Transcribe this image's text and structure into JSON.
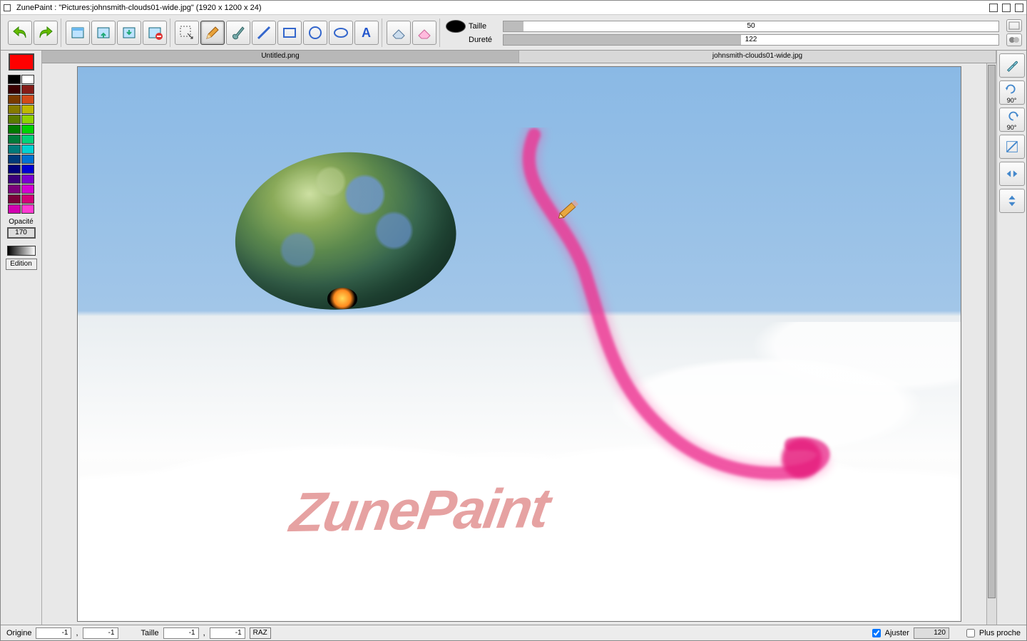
{
  "app_name": "ZunePaint",
  "title_suffix": " : \"Pictures:johnsmith-clouds01-wide.jpg\" (1920 x 1200 x 24)",
  "toolbar": {
    "taille_label": "Taille",
    "taille_value": "50",
    "taille_pct": 4,
    "durete_label": "Dureté",
    "durete_value": "122",
    "durete_pct": 48
  },
  "tabs": [
    {
      "label": "Untitled.png",
      "active": false
    },
    {
      "label": "johnsmith-clouds01-wide.jpg",
      "active": true
    }
  ],
  "palette": {
    "current": "#ff0000",
    "opacity_label": "Opacité",
    "opacity_value": "170",
    "edition_label": "Edition",
    "colors": [
      "#000000",
      "#ffffff",
      "#3a0000",
      "#861c17",
      "#7a3a00",
      "#d24a1a",
      "#867a00",
      "#bfb800",
      "#5a7a00",
      "#8fd200",
      "#007a00",
      "#00d200",
      "#007a3a",
      "#00d27a",
      "#007a7a",
      "#00d2d2",
      "#003a7a",
      "#0072d2",
      "#00007a",
      "#0000d2",
      "#3a007a",
      "#7a00d2",
      "#7a007a",
      "#d200d2",
      "#7a003a",
      "#d2007a",
      "#d200b0",
      "#ff3ad2"
    ]
  },
  "right_panel": {
    "rotate_cw": "90°",
    "rotate_ccw": "90°"
  },
  "status": {
    "origine_label": "Origine",
    "ox": "-1",
    "oy": "-1",
    "taille_label": "Taille",
    "tw": "-1",
    "th": "-1",
    "raz": "RAZ",
    "ajuster": "Ajuster",
    "zoom": "120",
    "plus_proche": "Plus proche"
  },
  "canvas": {
    "watermark": "ZunePaint"
  }
}
